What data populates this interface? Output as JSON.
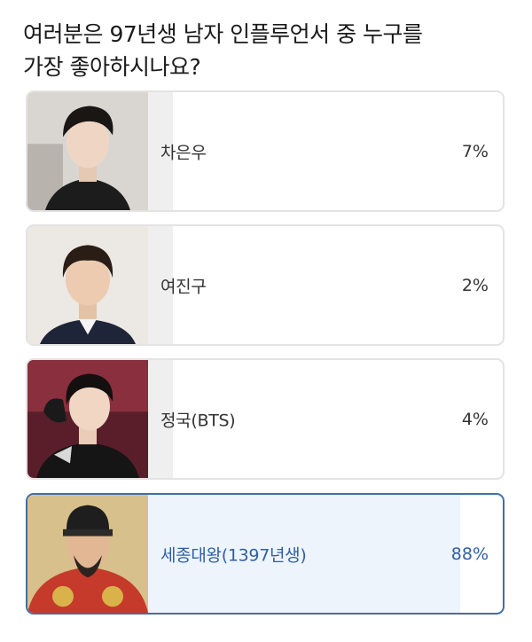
{
  "poll": {
    "question_line1": "여러분은 97년생 남자 인플루언서 중 누구를",
    "question_line2": "가장 좋아하시나요?",
    "options": [
      {
        "name": "차은우",
        "percent": "7%",
        "bar_fraction": 0.07,
        "selected": false
      },
      {
        "name": "여진구",
        "percent": "2%",
        "bar_fraction": 0.02,
        "selected": false
      },
      {
        "name": "정국(BTS)",
        "percent": "4%",
        "bar_fraction": 0.04,
        "selected": false
      },
      {
        "name": "세종대왕(1397년생)",
        "percent": "88%",
        "bar_fraction": 0.88,
        "selected": true
      }
    ]
  },
  "colors": {
    "selected_border": "#3f6fa8",
    "selected_text": "#2f5fa3",
    "selected_bar": "#eef4fc",
    "default_bar": "#efefef"
  }
}
